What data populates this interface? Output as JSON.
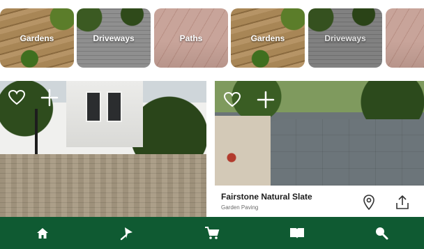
{
  "categories": [
    {
      "label": "Gardens",
      "icon": "garden-photo"
    },
    {
      "label": "Driveways",
      "icon": "driveway-photo"
    },
    {
      "label": "Paths",
      "icon": "path-photo"
    },
    {
      "label": "Gardens",
      "icon": "garden-photo"
    },
    {
      "label": "Driveways",
      "icon": "driveway-photo"
    },
    {
      "label": "",
      "icon": "path-photo"
    }
  ],
  "products": [
    {
      "title": "",
      "subtitle": "",
      "favorite_icon": "heart-outline-icon",
      "add_icon": "plus-icon"
    },
    {
      "title": "Fairstone Natural Slate",
      "subtitle": "Garden Paving",
      "favorite_icon": "heart-outline-icon",
      "add_icon": "plus-icon",
      "location_icon": "map-pin-icon",
      "share_icon": "share-icon"
    }
  ],
  "bottom_nav": {
    "background": "#0f5a32",
    "items": [
      {
        "icon": "home-icon"
      },
      {
        "icon": "trowel-icon"
      },
      {
        "icon": "cart-icon"
      },
      {
        "icon": "book-icon"
      },
      {
        "icon": "search-icon"
      }
    ]
  }
}
